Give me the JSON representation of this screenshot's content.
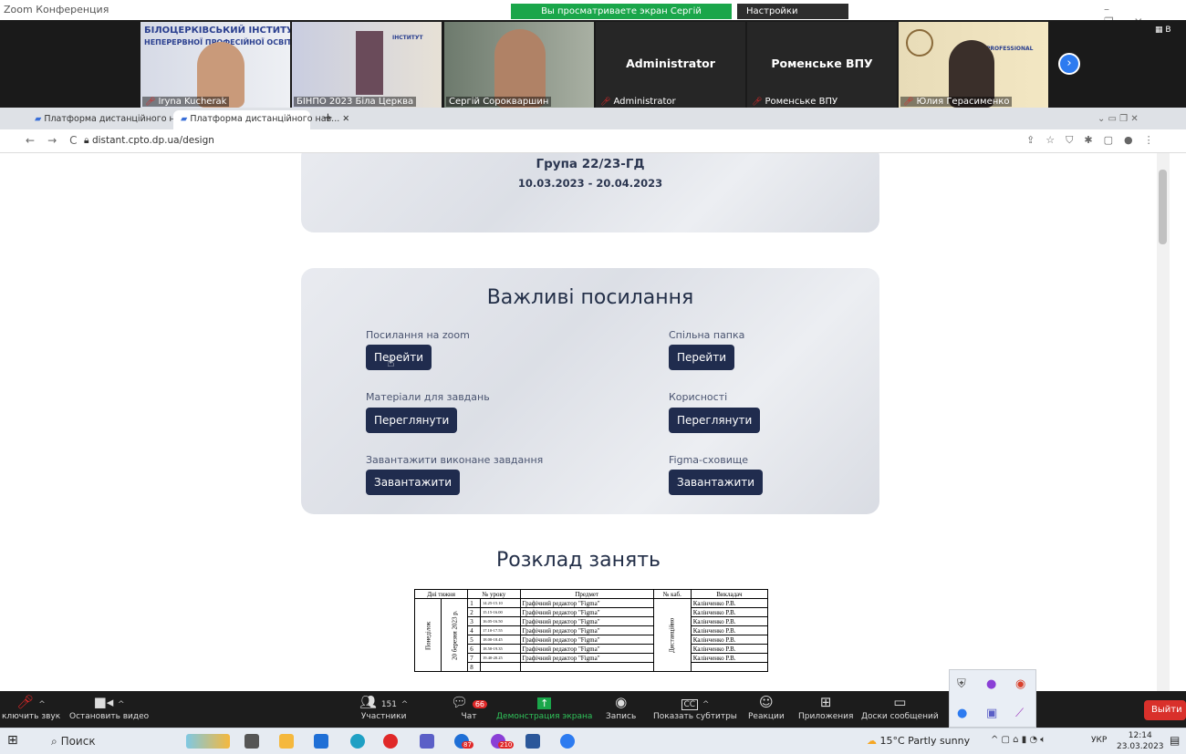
{
  "zoom": {
    "title": "Zoom Конференция",
    "viewing_banner": "Вы просматриваете экран Сергій Сорокваршин",
    "view_settings": "Настройки просмотра",
    "participants": [
      {
        "name": "Iryna Kucherak",
        "muted": true
      },
      {
        "name": "БІНПО 2023 Біла Церква",
        "muted": false
      },
      {
        "name": "Сергій Сорокваршин",
        "muted": false
      },
      {
        "name": "Administrator",
        "muted": true,
        "center_label": "Administrator"
      },
      {
        "name": "Роменське ВПУ",
        "muted": true,
        "center_label": "Роменське ВПУ"
      },
      {
        "name": "Юлия Герасименко",
        "muted": true
      }
    ],
    "tile_text": {
      "institute_line1": "БІЛОЦЕРКІВСЬКИЙ ІНСТИТУТ",
      "institute_line2": "НЕПЕРЕРВНОЇ ПРОФЕСІЙНОЇ ОСВІТИ",
      "institute_short": "ІНСТИТУТ",
      "professional": "PROFESSIONAL"
    },
    "gallery_label": "В"
  },
  "browser": {
    "tabs": [
      {
        "label": "Платформа дистанційного нав...",
        "active": false
      },
      {
        "label": "Платформа дистанційного нав...",
        "active": true
      }
    ],
    "url": "distant.cpto.dp.ua/design"
  },
  "page": {
    "group": "Група 22/23-ГД",
    "dates": "10.03.2023 - 20.04.2023",
    "links_title": "Важливі посилання",
    "links": [
      {
        "label": "Посилання на zoom",
        "button": "Перейти"
      },
      {
        "label": "Спільна папка",
        "button": "Перейти"
      },
      {
        "label": "Матеріали для завдань",
        "button": "Переглянути"
      },
      {
        "label": "Корисності",
        "button": "Переглянути"
      },
      {
        "label": "Завантажити виконане завдання",
        "button": "Завантажити"
      },
      {
        "label": "Figma-сховище",
        "button": "Завантажити"
      }
    ],
    "schedule_title": "Розклад занять",
    "schedule": {
      "headers": [
        "Дні тижня",
        "№ уроку",
        "Предмет",
        "№ каб.",
        "Викладач"
      ],
      "day": "Понеділок",
      "date": "20 березня 2023 р.",
      "room": "Дистанційно",
      "rows": [
        {
          "n": "1",
          "time": "14.25-15.10",
          "subject": "Графічний редактор \"Figma\"",
          "teacher": "Калінченко Р.В."
        },
        {
          "n": "2",
          "time": "15.15-16.00",
          "subject": "Графічний редактор \"Figma\"",
          "teacher": "Калінченко Р.В."
        },
        {
          "n": "3",
          "time": "16.05-16.50",
          "subject": "Графічний редактор \"Figma\"",
          "teacher": "Калінченко Р.В."
        },
        {
          "n": "4",
          "time": "17.10-17.55",
          "subject": "Графічний редактор \"Figma\"",
          "teacher": "Калінченко Р.В."
        },
        {
          "n": "5",
          "time": "18.00-18.45",
          "subject": "Графічний редактор \"Figma\"",
          "teacher": "Калінченко Р.В."
        },
        {
          "n": "6",
          "time": "18.50-19.35",
          "subject": "Графічний редактор \"Figma\"",
          "teacher": "Калінченко Р.В."
        },
        {
          "n": "7",
          "time": "19.40-20.25",
          "subject": "Графічний редактор \"Figma\"",
          "teacher": "Калінченко Р.В."
        },
        {
          "n": "8",
          "time": "",
          "subject": "",
          "teacher": ""
        }
      ]
    }
  },
  "toolbar": {
    "unmute": "ключить звук",
    "stop_video": "Остановить видео",
    "participants": "Участники",
    "participants_count": "151",
    "chat": "Чат",
    "chat_badge": "66",
    "share": "Демонстрация экрана",
    "record": "Запись",
    "captions": "Показать субтитры",
    "reactions": "Реакции",
    "apps": "Приложения",
    "whiteboards": "Доски сообщений",
    "leave": "Выйти"
  },
  "taskbar": {
    "search": "Поиск",
    "weather": "15°C  Partly sunny",
    "lang": "УКР",
    "time": "12:14",
    "date": "23.03.2023",
    "badges": [
      "87",
      "210"
    ]
  },
  "colors": {
    "zoom_green": "#1aa64a",
    "button_navy": "#202c4e",
    "leave_red": "#d9302b",
    "zoom_blue": "#2d7bf0"
  }
}
